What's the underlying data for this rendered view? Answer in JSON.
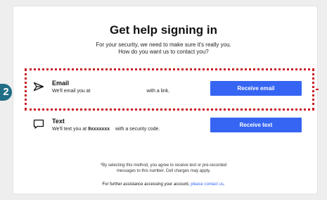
{
  "marker": "2",
  "title": "Get help signing in",
  "subtitle_line1": "For your security, we need to make sure it's really you.",
  "subtitle_line2": "How do you want us to contact you?",
  "email_option": {
    "icon": "send-icon",
    "title": "Email",
    "desc_prefix": "We'll email you at",
    "desc_suffix": "with a link.",
    "button": "Receive email"
  },
  "text_option": {
    "icon": "message-icon",
    "title": "Text",
    "desc_prefix": "We'll text you at",
    "masked_number": "9xxxxxxx",
    "desc_suffix": "with a security code.",
    "button": "Receive text"
  },
  "disclaimer_line1": "*By selecting this method, you agree to receive text or pre-recorded",
  "disclaimer_line2": "messages to this number. Cell charges may apply.",
  "further_text": "For further assistance accessing your account,",
  "contact_link": "please contact us",
  "further_end": ".",
  "colors": {
    "accent": "#3665f3",
    "highlight": "#cc1f24",
    "marker": "#1f6e86"
  }
}
